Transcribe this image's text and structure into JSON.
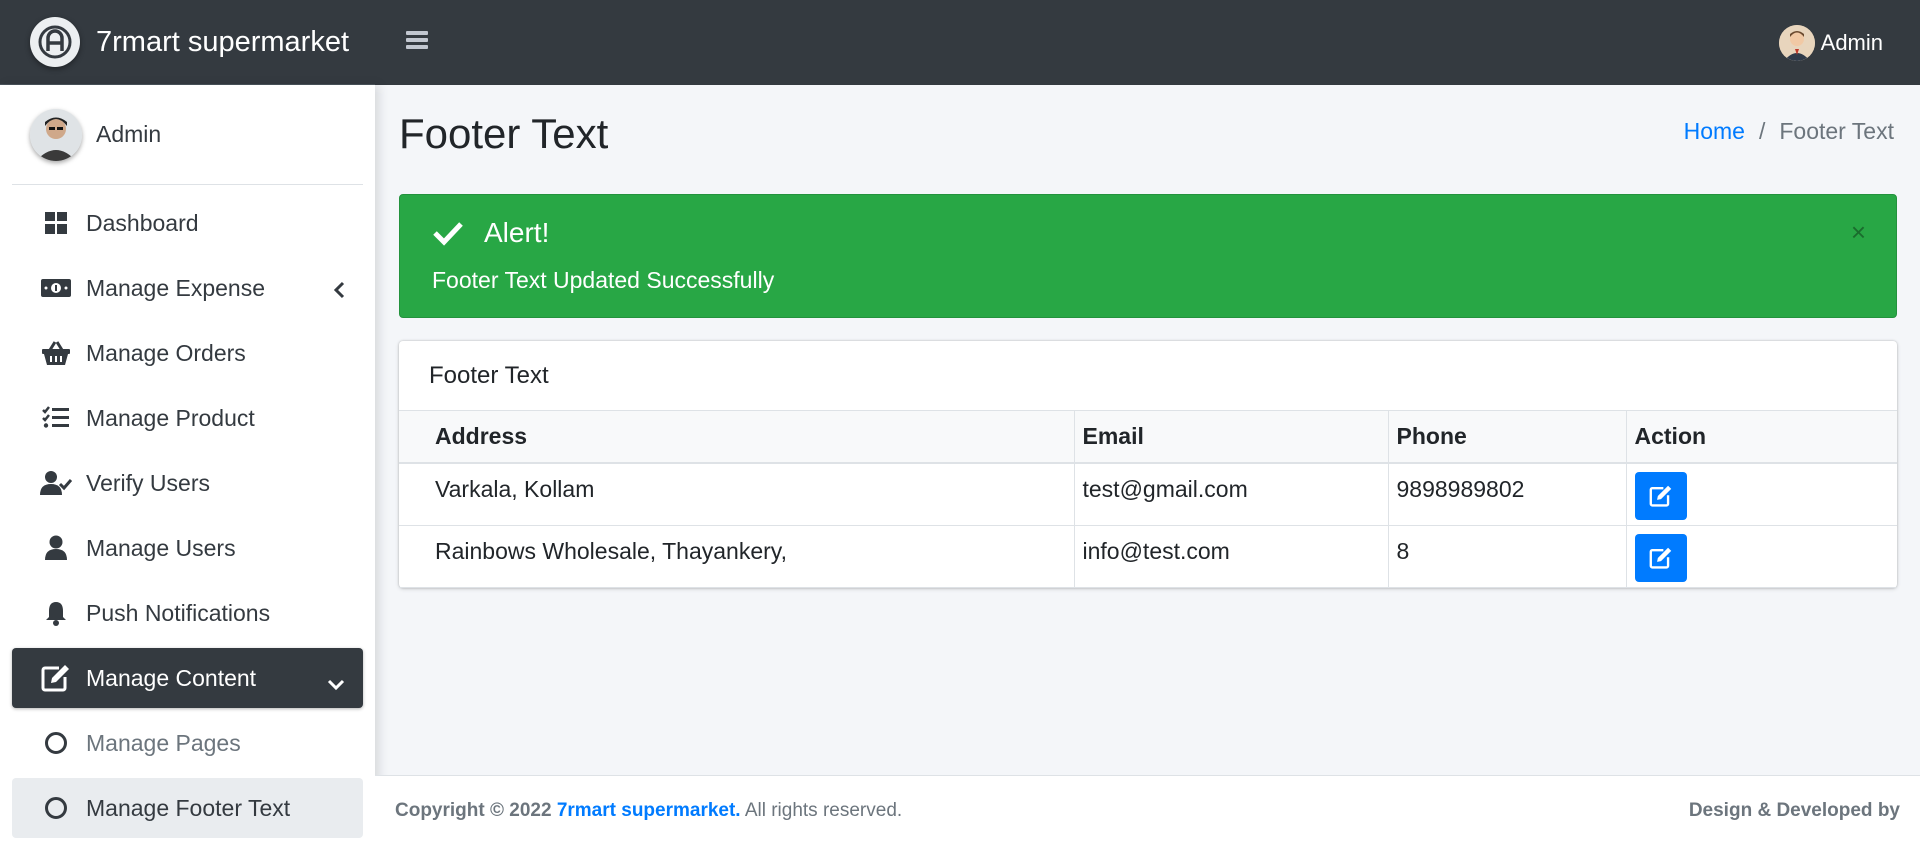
{
  "brand": {
    "name": "7rmart supermarket"
  },
  "topbar": {
    "user_name": "Admin"
  },
  "sidebar": {
    "user_name": "Admin",
    "items": [
      {
        "label": "Dashboard",
        "icon": "dashboard-icon"
      },
      {
        "label": "Manage Expense",
        "icon": "money-bill-icon"
      },
      {
        "label": "Manage Orders",
        "icon": "basket-icon"
      },
      {
        "label": "Manage Product",
        "icon": "list-check-icon"
      },
      {
        "label": "Verify Users",
        "icon": "user-check-icon"
      },
      {
        "label": "Manage Users",
        "icon": "user-icon"
      },
      {
        "label": "Push Notifications",
        "icon": "bell-icon"
      },
      {
        "label": "Manage Content",
        "icon": "edit-icon"
      },
      {
        "label": "Manage Pages",
        "icon": "circle-icon"
      },
      {
        "label": "Manage Footer Text",
        "icon": "circle-icon"
      }
    ]
  },
  "page": {
    "title": "Footer Text",
    "breadcrumb": {
      "home": "Home",
      "current": "Footer Text",
      "separator": "/"
    }
  },
  "alert": {
    "title": "Alert!",
    "message": "Footer Text Updated Successfully",
    "close": "×",
    "color": "#28a745"
  },
  "card": {
    "title": "Footer Text",
    "columns": [
      "Address",
      "Email",
      "Phone",
      "Action"
    ],
    "rows": [
      {
        "address": "Varkala, Kollam",
        "email": "test@gmail.com",
        "phone": "9898989802"
      },
      {
        "address": "Rainbows Wholesale, Thayankery,",
        "email": "info@test.com",
        "phone": "8"
      }
    ]
  },
  "footer": {
    "copyright_prefix": "Copyright © 2022",
    "brand_link": "7rmart supermarket.",
    "rights": "All rights reserved.",
    "right_text": "Design & Developed by"
  },
  "colors": {
    "primary": "#007bff",
    "dark": "#343a40",
    "success": "#28a745"
  }
}
